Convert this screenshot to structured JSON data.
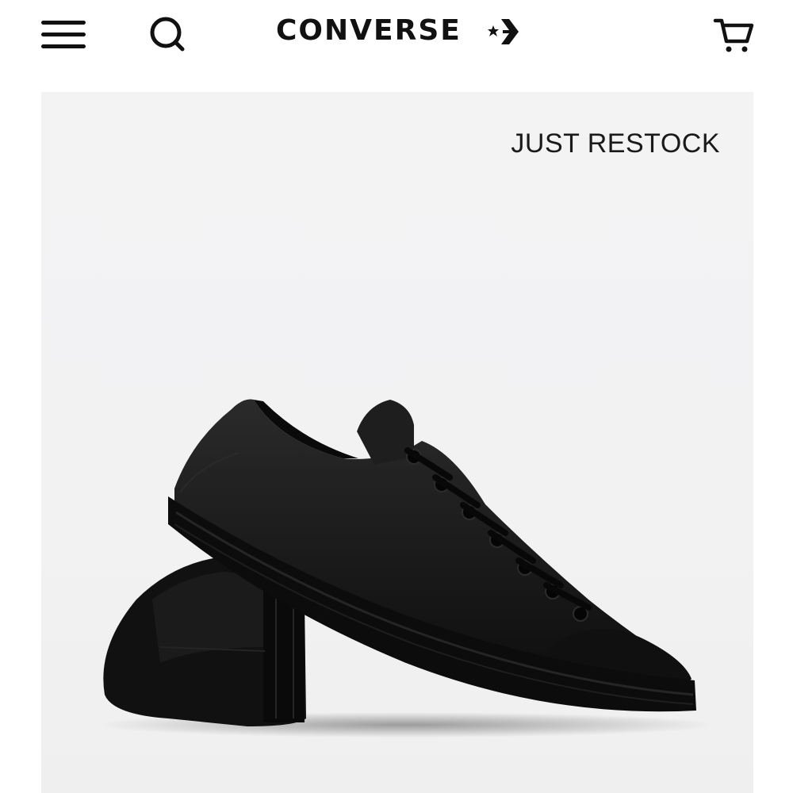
{
  "header": {
    "logo_text": "CONVERSE",
    "menu_icon": "hamburger-menu-icon",
    "search_icon": "search-icon",
    "cart_icon": "shopping-cart-icon"
  },
  "hero": {
    "label": "JUST RESTOCK",
    "image": "black-leather-low-top-sneakers"
  },
  "colors": {
    "text": "#111111",
    "hero_background": "#f3f3f4",
    "shoe": "#141414"
  }
}
